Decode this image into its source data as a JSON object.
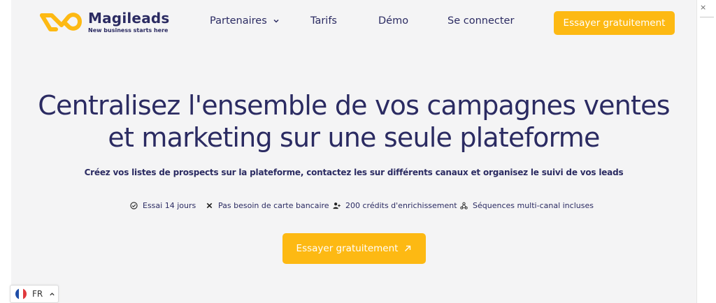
{
  "header": {
    "logo_name": "Magileads",
    "logo_tagline": "New business starts here",
    "nav": {
      "partners": "Partenaires",
      "tarifs": "Tarifs",
      "demo": "Démo",
      "login": "Se connecter"
    },
    "cta_label": "Essayer gratuitement"
  },
  "hero": {
    "title_line1": "Centralisez l'ensemble de vos campagnes ventes",
    "title_line2": "et marketing sur une seule plateforme",
    "subtitle": "Créez vos listes de prospects sur la plateforme, contactez les sur différents canaux et organisez le suivi de vos leads",
    "features": [
      {
        "icon": "check-circle-icon",
        "label": "Essai 14 jours"
      },
      {
        "icon": "x-icon",
        "label": "Pas besoin de carte bancaire"
      },
      {
        "icon": "user-plus-icon",
        "label": "200 crédits d'enrichissement"
      },
      {
        "icon": "network-icon",
        "label": "Séquences multi-canal incluses"
      }
    ],
    "cta_label": "Essayer gratuitement"
  },
  "language_switcher": {
    "code": "FR"
  },
  "colors": {
    "brand_navy": "#2b2b62",
    "accent_yellow": "#fdb913",
    "background": "#f4f4f5"
  }
}
